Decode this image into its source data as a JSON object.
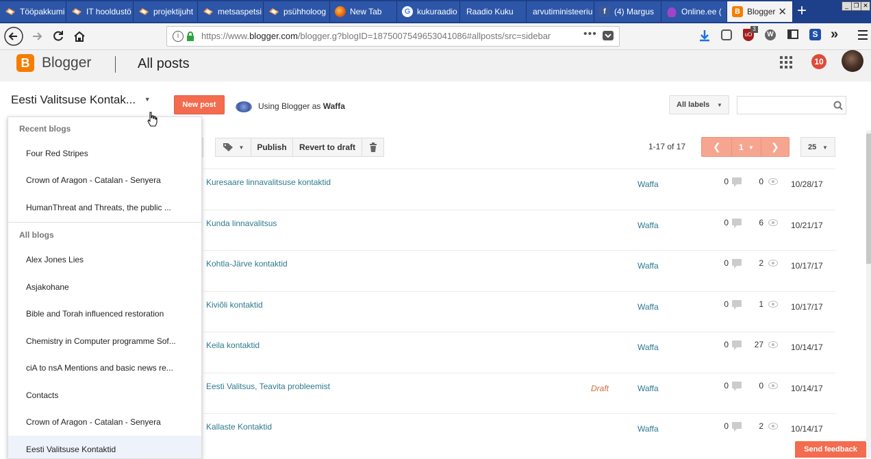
{
  "browser": {
    "tabs": [
      {
        "label": "Tööpakkumi",
        "icon": "blogger-pen-icon"
      },
      {
        "label": "IT hooldustö",
        "icon": "blogger-pen-icon"
      },
      {
        "label": "projektijuht",
        "icon": "blogger-pen-icon"
      },
      {
        "label": "metsaspetsi",
        "icon": "blogger-pen-icon"
      },
      {
        "label": "psühholoog",
        "icon": "blogger-pen-icon"
      },
      {
        "label": "New Tab",
        "icon": "firefox-icon"
      },
      {
        "label": "kukuraadio",
        "icon": "google-icon"
      },
      {
        "label": "Raadio Kuku",
        "icon": ""
      },
      {
        "label": "arvutiministeeriu",
        "icon": ""
      },
      {
        "label": "(4) Margus",
        "icon": "facebook-icon"
      },
      {
        "label": "Online.ee (",
        "icon": "cloud-icon"
      },
      {
        "label": "Blogger",
        "icon": "blogger-icon"
      }
    ],
    "new_tab_glyph": "+",
    "url": {
      "prefix": "https://www.",
      "domain": "blogger.com",
      "path": "/blogger.g?blogID=1875007549653041086#allposts/src=sidebar"
    },
    "ublock_badge": "3"
  },
  "header": {
    "brand": "Blogger",
    "page_title": "All posts",
    "notification_count": "10"
  },
  "controls": {
    "current_blog": "Eesti Valitsuse Kontak...",
    "new_post_label": "New post",
    "using_prefix": "Using Blogger as ",
    "using_name": "Waffa",
    "labels_button": "All labels"
  },
  "toolbar": {
    "publish_label": "Publish",
    "revert_label": "Revert to draft",
    "range_text": "1-17 of 17",
    "page_number": "1",
    "per_page": "25"
  },
  "posts": [
    {
      "title": "Kuresaare linnavalitsuse kontaktid",
      "status": "",
      "author": "Waffa",
      "comments": "0",
      "views": "0",
      "date": "10/28/17"
    },
    {
      "title": "Kunda linnavalitsus",
      "status": "",
      "author": "Waffa",
      "comments": "0",
      "views": "6",
      "date": "10/21/17"
    },
    {
      "title": "Kohtla-Järve kontaktid",
      "status": "",
      "author": "Waffa",
      "comments": "0",
      "views": "2",
      "date": "10/17/17"
    },
    {
      "title": "Kiviõli kontaktid",
      "status": "",
      "author": "Waffa",
      "comments": "0",
      "views": "1",
      "date": "10/17/17"
    },
    {
      "title": "Keila kontaktid",
      "status": "",
      "author": "Waffa",
      "comments": "0",
      "views": "27",
      "date": "10/14/17"
    },
    {
      "title": "Eesti Valitsus, Teavita probleemist",
      "status": "Draft",
      "author": "Waffa",
      "comments": "0",
      "views": "0",
      "date": "10/14/17"
    },
    {
      "title": "Kallaste Kontaktid",
      "status": "",
      "author": "Waffa",
      "comments": "0",
      "views": "2",
      "date": "10/14/17"
    }
  ],
  "blog_menu": {
    "recent_heading": "Recent blogs",
    "recent": [
      "Four Red Stripes",
      "Crown of Aragon - Catalan - Senyera",
      "HumanThreat and Threats, the public ..."
    ],
    "all_heading": "All blogs",
    "all": [
      "Alex Jones Lies",
      "Asjakohane",
      "Bible and Torah influenced restoration",
      "Chemistry in Computer programme Sof...",
      "ciA to nsA Mentions and basic news re...",
      "Contacts",
      "Crown of Aragon - Catalan - Senyera",
      "Eesti Valitsuse Kontaktid"
    ],
    "selected_index": 7
  },
  "feedback_label": "Send feedback",
  "colors": {
    "accent": "#f36c4f",
    "link": "#2c7a8e",
    "brand_orange": "#f57d00",
    "tab_bar": "#1e3f8a"
  }
}
